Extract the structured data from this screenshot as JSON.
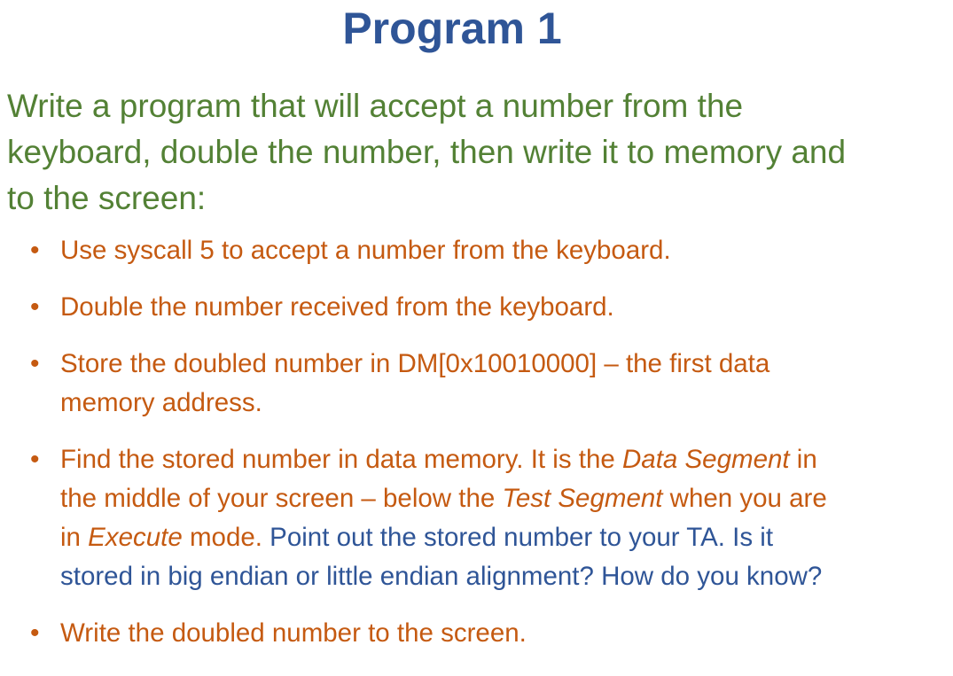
{
  "title": "Program 1",
  "intro": [
    "Write a program that will accept a number from the",
    "keyboard, double the number, then write it to memory and",
    "to the screen:"
  ],
  "colors": {
    "title": "#2F5597",
    "intro": "#538135",
    "orange": "#C55A11",
    "blue": "#2F5597"
  },
  "bullets": [
    {
      "lines": [
        [
          {
            "text": "Use syscall 5 to accept a number from the keyboard.",
            "style": "orange"
          }
        ]
      ]
    },
    {
      "lines": [
        [
          {
            "text": "Double the number received from the keyboard.",
            "style": "orange"
          }
        ]
      ]
    },
    {
      "lines": [
        [
          {
            "text": "Store the doubled number in DM[0x10010000] – the first data",
            "style": "orange"
          }
        ],
        [
          {
            "text": "memory address.",
            "style": "orange"
          }
        ]
      ]
    },
    {
      "lines": [
        [
          {
            "text": "Find the stored number in data memory. It is the ",
            "style": "orange"
          },
          {
            "text": "Data Segment",
            "style": "orange it"
          },
          {
            "text": " in",
            "style": "orange"
          }
        ],
        [
          {
            "text": "the middle of your screen – below the ",
            "style": "orange"
          },
          {
            "text": "Test Segment",
            "style": "orange it"
          },
          {
            "text": " when you are",
            "style": "orange"
          }
        ],
        [
          {
            "text": "in ",
            "style": "orange"
          },
          {
            "text": "Execute",
            "style": "orange it"
          },
          {
            "text": " mode. ",
            "style": "orange"
          },
          {
            "text": "Point out the stored number to your TA. Is it",
            "style": "blue"
          }
        ],
        [
          {
            "text": "stored in big endian or little endian alignment? How do you know?",
            "style": "blue"
          }
        ]
      ]
    },
    {
      "lines": [
        [
          {
            "text": "Write the doubled number to the screen.",
            "style": "orange"
          }
        ]
      ]
    }
  ]
}
